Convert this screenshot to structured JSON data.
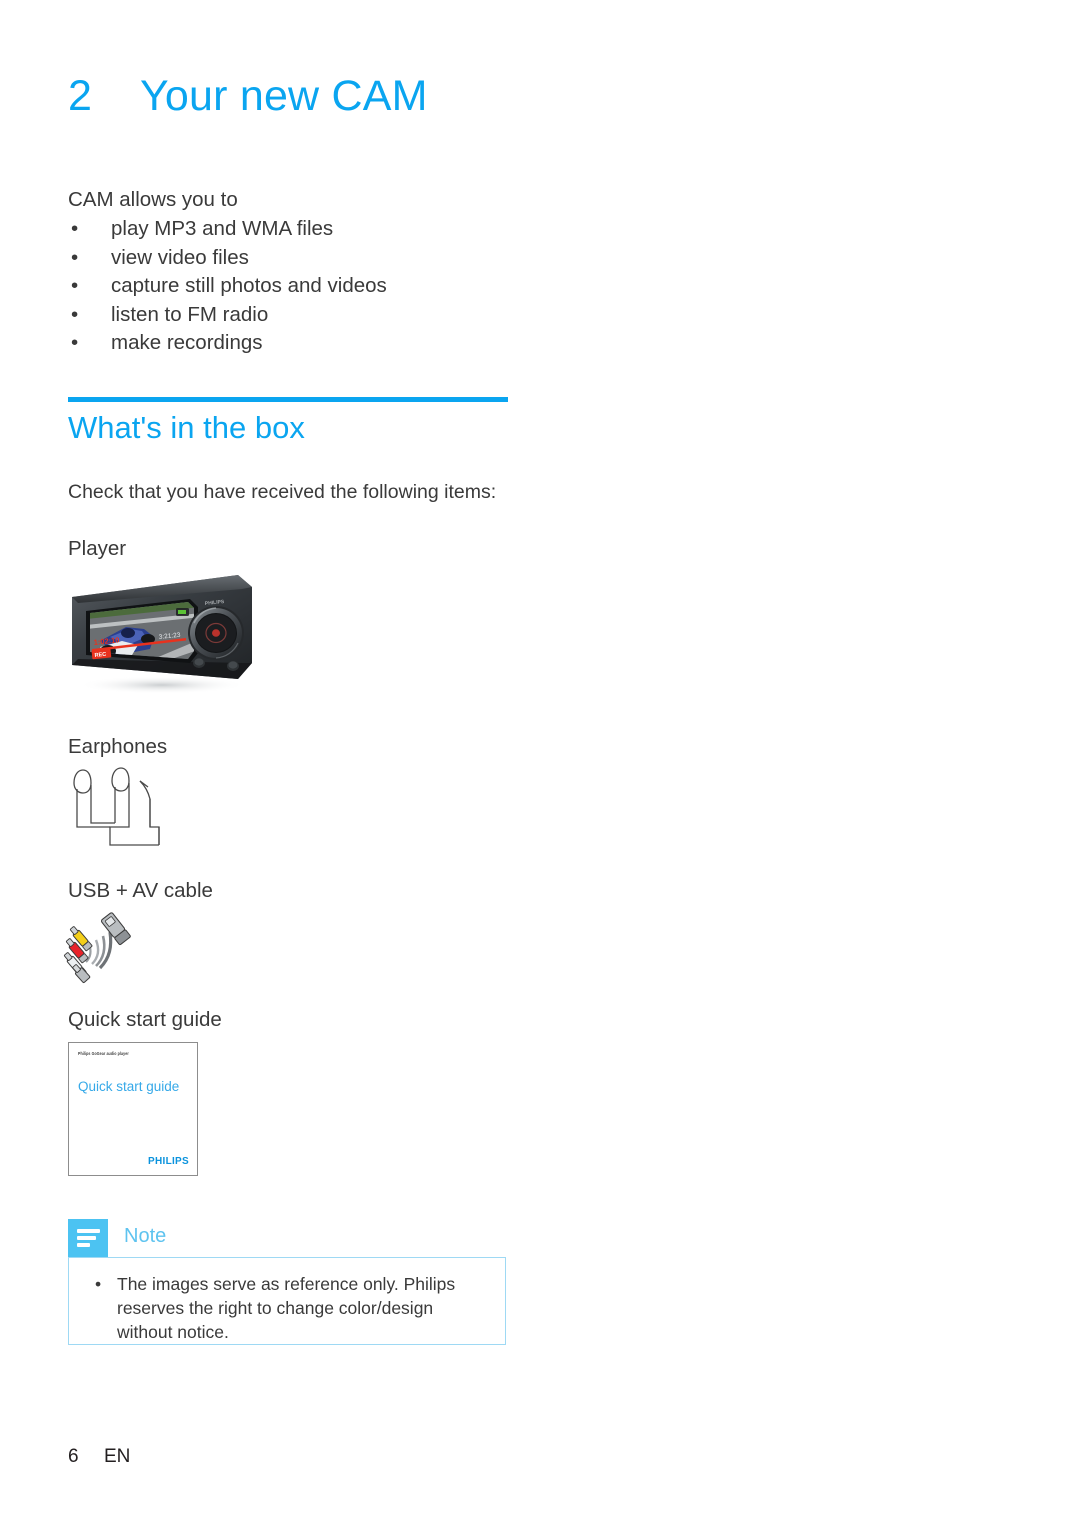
{
  "chapter": {
    "number": "2",
    "title": "Your new CAM"
  },
  "intro": {
    "lead": "CAM allows you to",
    "features": [
      "play MP3 and WMA files",
      "view video files",
      "capture still photos and videos",
      "listen to FM radio",
      "make recordings"
    ],
    "bullet": "•"
  },
  "section": {
    "heading": "What's in the box",
    "lead": "Check that you have received the following items:"
  },
  "items": [
    {
      "label": "Player"
    },
    {
      "label": "Earphones"
    },
    {
      "label": "USB + AV cable"
    },
    {
      "label": "Quick start guide"
    }
  ],
  "device_screen": {
    "time_elapsed": "1:02:10",
    "time_total": "3:21:23",
    "rec_badge": "REC",
    "brand": "PHILIPS"
  },
  "booklet": {
    "header": "Philips GoGear audio player",
    "title": "Quick start guide",
    "logo": "PHILIPS"
  },
  "note": {
    "title": "Note",
    "bullet": "•",
    "items": [
      "The images serve as reference only. Philips reserves the right to change color/design without notice."
    ]
  },
  "footer": {
    "page": "6",
    "language": "EN"
  },
  "colors": {
    "accent_blue": "#0aa5f0",
    "note_tab": "#4cc3f2",
    "note_border": "#9ed9f4",
    "note_title": "#5ec3ef",
    "body_text": "#3a3a3a",
    "rec_red": "#e8321e",
    "cable_yellow": "#f4cf1a",
    "cable_red": "#e8232a"
  }
}
